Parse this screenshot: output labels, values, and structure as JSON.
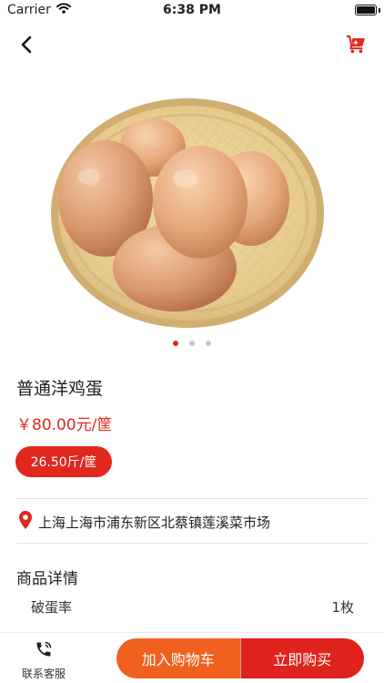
{
  "status_bar": {
    "carrier": "Carrier",
    "time": "6:38 PM"
  },
  "nav": {
    "back_icon": "chevron-left-icon",
    "cart_icon": "shopping-cart-icon",
    "accent": "#e0281e"
  },
  "carousel": {
    "slide_count": 3,
    "active_index": 0
  },
  "product": {
    "title": "普通洋鸡蛋",
    "price": "￥80.00元/筐",
    "unit_price": "26.50斤/筐",
    "location": "上海上海市浦东新区北蔡镇莲溪菜市场"
  },
  "details": {
    "title": "商品详情",
    "rows": [
      {
        "label": "破蛋率",
        "value": "1枚"
      }
    ]
  },
  "bottom_bar": {
    "service_label": "联系客服",
    "add_cart_label": "加入购物车",
    "buy_now_label": "立即购买",
    "add_cart_color": "#f0611f",
    "buy_now_color": "#e0231c"
  }
}
